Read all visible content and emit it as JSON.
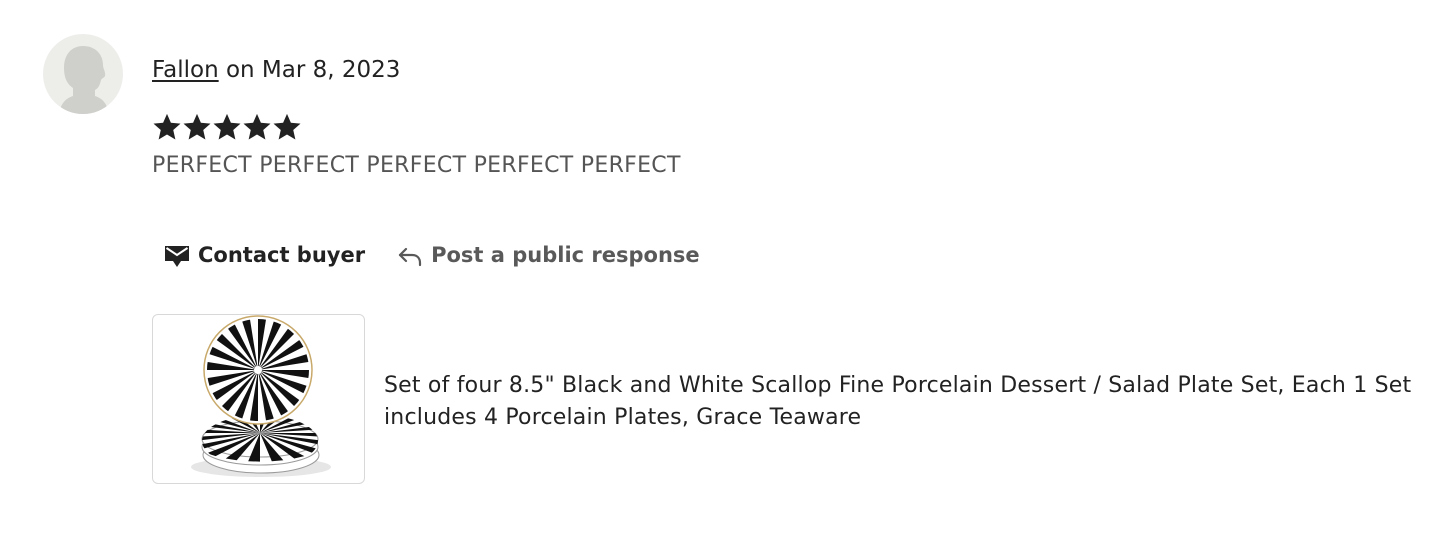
{
  "review": {
    "reviewer_name": "Fallon",
    "date_text": " on Mar 8, 2023",
    "rating": 5,
    "rating_max": 5,
    "text": "PERFECT PERFECT PERFECT PERFECT PERFECT"
  },
  "actions": {
    "contact_label": "Contact buyer",
    "contact_icon": "envelope-icon",
    "response_label": "Post a public response",
    "response_icon": "reply-arrow-icon"
  },
  "product": {
    "title": "Set of four 8.5\" Black and White Scallop Fine Porcelain Dessert / Salad Plate Set, Each 1 Set includes 4 Porcelain Plates, Grace Teaware"
  },
  "colors": {
    "star": "#222222",
    "avatar_bg": "#ededea",
    "avatar_silhouette": "#cfcfcb"
  }
}
